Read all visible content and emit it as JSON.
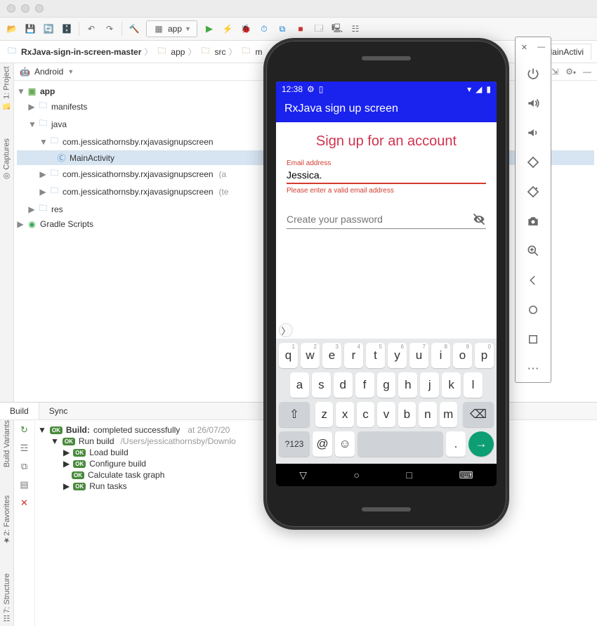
{
  "toolbar": {
    "run_config": "app"
  },
  "breadcrumb": {
    "items": [
      "RxJava-sign-in-screen-master",
      "app",
      "src",
      "m"
    ],
    "editor_tab": "MainActivi"
  },
  "project": {
    "view_mode": "Android",
    "tree": {
      "app": "app",
      "manifests": "manifests",
      "java": "java",
      "pkg1": "com.jessicathornsby.rxjavasignupscreen",
      "main_activity": "MainActivity",
      "pkg2_a": "com.jessicathornsby.rxjavasignupscreen",
      "pkg2_suffix": "(a",
      "pkg3_a": "com.jessicathornsby.rxjavasignupscreen",
      "pkg3_suffix": "(te",
      "res": "res",
      "gradle": "Gradle Scripts"
    }
  },
  "sidebar_left": {
    "project": "1: Project",
    "captures": "Captures"
  },
  "sidebar_bottom_left": {
    "variants": "Build Variants",
    "favorites": "2: Favorites",
    "structure": "7: Structure"
  },
  "build": {
    "tab_build": "Build",
    "tab_sync": "Sync",
    "root_a": "Build:",
    "root_b": "completed successfully",
    "root_time": "at 26/07/20",
    "run_a": "Run build",
    "run_path": "/Users/jessicathornsby/Downlo",
    "load": "Load build",
    "configure": "Configure build",
    "calc": "Calculate task graph",
    "runtasks": "Run tasks"
  },
  "emulator": {
    "status_time": "12:38",
    "app_title": "RxJava sign up screen",
    "heading": "Sign up for an account",
    "email_label": "Email address",
    "email_value": "Jessica.",
    "email_error": "Please enter a valid email address",
    "password_placeholder": "Create your password",
    "keyboard": {
      "row1": [
        [
          "q",
          "1"
        ],
        [
          "w",
          "2"
        ],
        [
          "e",
          "3"
        ],
        [
          "r",
          "4"
        ],
        [
          "t",
          "5"
        ],
        [
          "y",
          "6"
        ],
        [
          "u",
          "7"
        ],
        [
          "i",
          "8"
        ],
        [
          "o",
          "9"
        ],
        [
          "p",
          "0"
        ]
      ],
      "row2": [
        "a",
        "s",
        "d",
        "f",
        "g",
        "h",
        "j",
        "k",
        "l"
      ],
      "row3": [
        "z",
        "x",
        "c",
        "v",
        "b",
        "n",
        "m"
      ],
      "sym": "?123",
      "at": "@"
    }
  }
}
